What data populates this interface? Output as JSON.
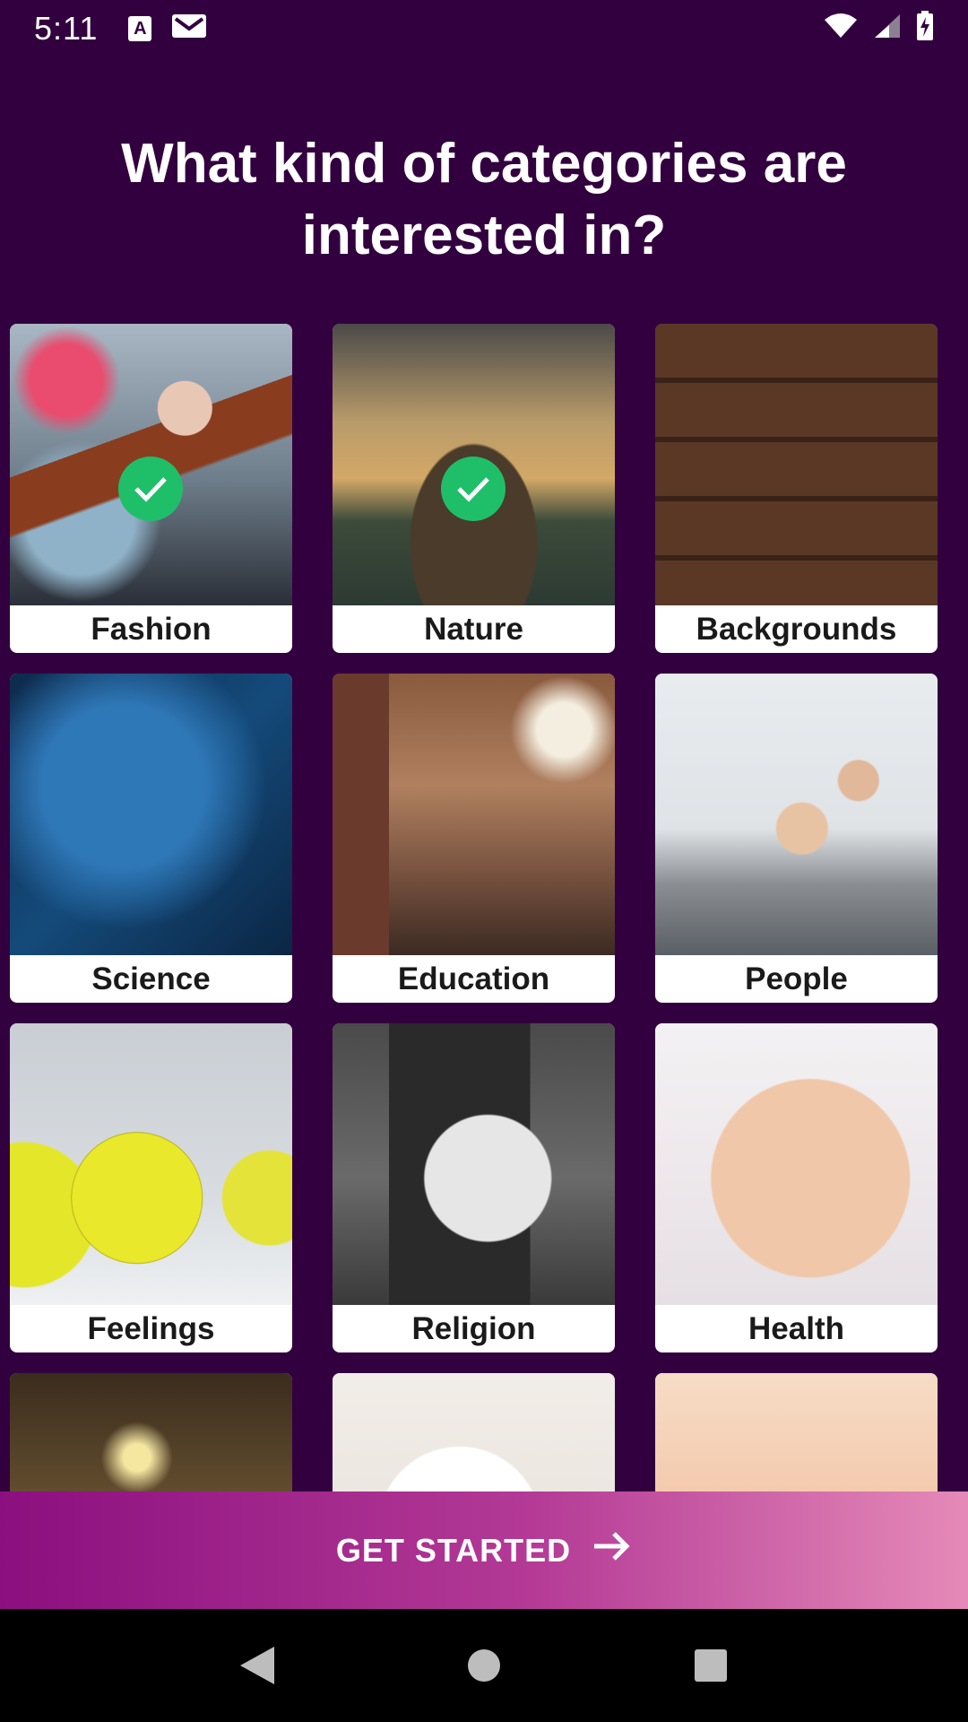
{
  "status_bar": {
    "time": "5:11",
    "notif_letter": "A",
    "icons": [
      "a-notification-icon",
      "gmail-icon",
      "wifi-icon",
      "signal-icon",
      "battery-charging-icon"
    ]
  },
  "headline": "What kind of categories are interested in?",
  "categories": [
    {
      "label": "Fashion",
      "selected": true
    },
    {
      "label": "Nature",
      "selected": true
    },
    {
      "label": "Backgrounds",
      "selected": false
    },
    {
      "label": "Science",
      "selected": false
    },
    {
      "label": "Education",
      "selected": false
    },
    {
      "label": "People",
      "selected": false
    },
    {
      "label": "Feelings",
      "selected": false
    },
    {
      "label": "Religion",
      "selected": false
    },
    {
      "label": "Health",
      "selected": false
    }
  ],
  "cta": {
    "label": "GET STARTED",
    "icon": "arrow-right-icon"
  },
  "nav_bar": {
    "icons": [
      "back-icon",
      "home-icon",
      "recents-icon"
    ]
  },
  "colors": {
    "background": "#33003f",
    "check": "#1fbf6a",
    "cta_start": "#8b0f7f",
    "cta_end": "#e58ab8"
  }
}
